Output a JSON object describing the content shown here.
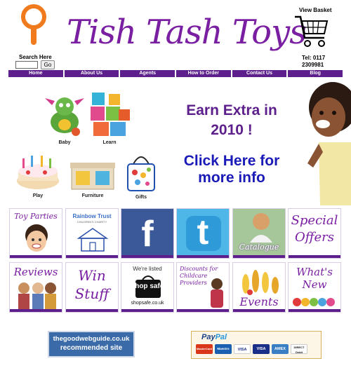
{
  "header": {
    "title": "Tish Tash Toys",
    "search_label": "Search Here",
    "search_button": "Go",
    "basket_label": "View Basket",
    "phone_line1": "Tel: 0117",
    "phone_line2": "2309981"
  },
  "nav": [
    "Home",
    "About Us",
    "Agents",
    "How to Order",
    "Contact Us",
    "Blog"
  ],
  "categories": [
    "Baby",
    "Learn",
    "Play",
    "Furniture",
    "Gifts"
  ],
  "promo": {
    "line1": "Earn Extra in",
    "line2": "2010 !",
    "link_line1": "Click Here for",
    "link_line2": "more info"
  },
  "tiles": {
    "toy_parties": "Toy Parties",
    "rainbow_trust": "Rainbow Trust",
    "rainbow_sub": "CHILDREN'S CHARITY",
    "facebook": "f",
    "twitter": "t",
    "catalogue": "Catalogue",
    "special_offers_1": "Special",
    "special_offers_2": "Offers",
    "reviews": "Reviews",
    "win_stuff_1": "Win",
    "win_stuff_2": "Stuff",
    "shopsafe_top": "We're listed",
    "shopsafe_main": "shop safe",
    "shopsafe_url": "shopsafe.co.uk",
    "discounts_1": "Discounts for",
    "discounts_2": "Childcare",
    "discounts_3": "Providers",
    "events": "Events",
    "whats_new_1": "What's",
    "whats_new_2": "New"
  },
  "footer": {
    "goodweb_line1": "thegoodwebguide.co.uk",
    "goodweb_line2": "recommended site",
    "paypal_1": "Pay",
    "paypal_2": "Pal",
    "cards": [
      "MasterCard",
      "Maestro",
      "VISA",
      "VISA",
      "AMEX",
      "DIRECT Debit"
    ]
  },
  "colors": {
    "brand_purple": "#7a1fa2",
    "nav_purple": "#5c1f8c",
    "link_blue": "#1a1ab8"
  }
}
